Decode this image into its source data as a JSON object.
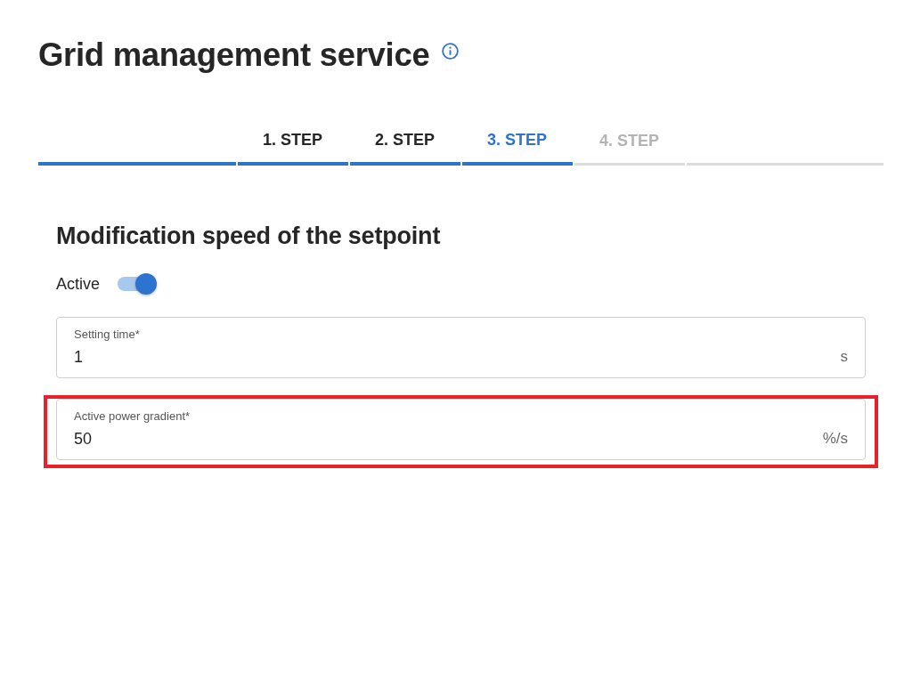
{
  "page": {
    "title": "Grid management service"
  },
  "stepper": {
    "steps": [
      {
        "label": "1. STEP",
        "selected": false,
        "disabled": false
      },
      {
        "label": "2. STEP",
        "selected": false,
        "disabled": false
      },
      {
        "label": "3. STEP",
        "selected": true,
        "disabled": false
      },
      {
        "label": "4. STEP",
        "selected": false,
        "disabled": true
      }
    ]
  },
  "section": {
    "title": "Modification speed of the setpoint",
    "toggle": {
      "label": "Active",
      "on": true
    },
    "fields": [
      {
        "label": "Setting time*",
        "value": "1",
        "unit": "s",
        "highlighted": false
      },
      {
        "label": "Active power gradient*",
        "value": "50",
        "unit": "%/s",
        "highlighted": true
      }
    ]
  }
}
